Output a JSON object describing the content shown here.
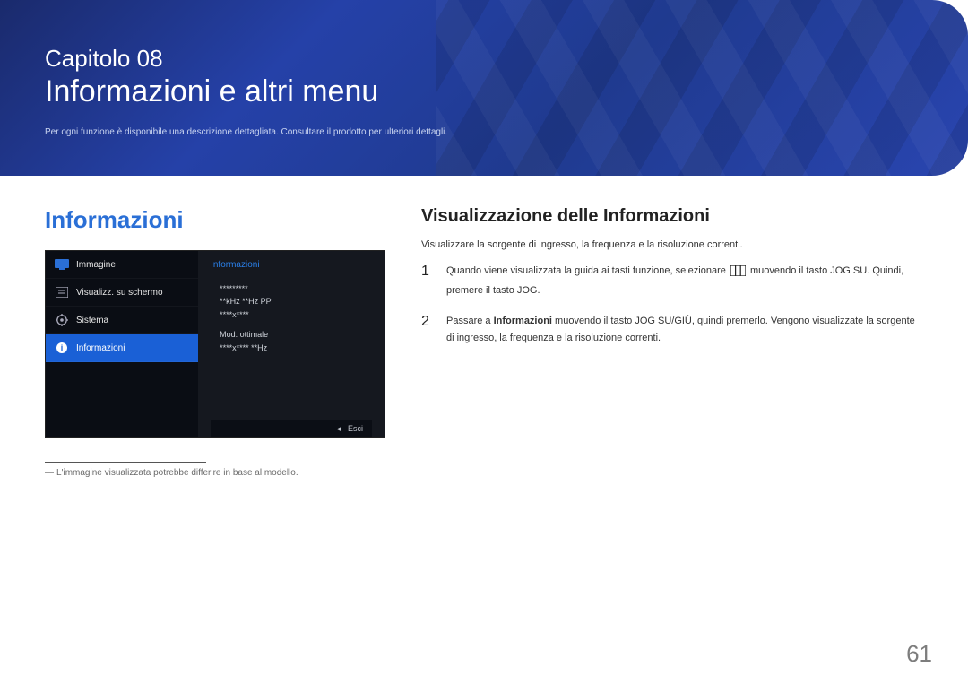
{
  "banner": {
    "chapter_label": "Capitolo 08",
    "chapter_title": "Informazioni e altri menu",
    "note": "Per ogni funzione è disponibile una descrizione dettagliata. Consultare il prodotto per ulteriori dettagli."
  },
  "left": {
    "section_title": "Informazioni",
    "osd": {
      "menu": {
        "item1": "Immagine",
        "item2": "Visualizz. su schermo",
        "item3": "Sistema",
        "item4": "Informazioni"
      },
      "panel_title": "Informazioni",
      "line_stars1": "*********",
      "line_khz": "**kHz **Hz PP",
      "line_res": "****x****",
      "line_mode": "Mod. ottimale",
      "line_opt": "****x**** **Hz",
      "footer": {
        "arrow": "◂",
        "exit": "Esci"
      }
    },
    "footnote_dash": "―",
    "footnote": "L'immagine visualizzata potrebbe differire in base al modello."
  },
  "right": {
    "section_title": "Visualizzazione delle Informazioni",
    "intro": "Visualizzare la sorgente di ingresso, la frequenza e la risoluzione correnti.",
    "step1": {
      "num": "1",
      "pre": "Quando viene visualizzata la guida ai tasti funzione, selezionare ",
      "post": " muovendo il tasto JOG SU. Quindi, premere il tasto JOG."
    },
    "step2": {
      "num": "2",
      "pre": "Passare a ",
      "bold": "Informazioni",
      "post": " muovendo il tasto JOG SU/GIÙ, quindi premerlo. Vengono visualizzate la sorgente di ingresso, la frequenza e la risoluzione correnti."
    }
  },
  "page_number": "61"
}
